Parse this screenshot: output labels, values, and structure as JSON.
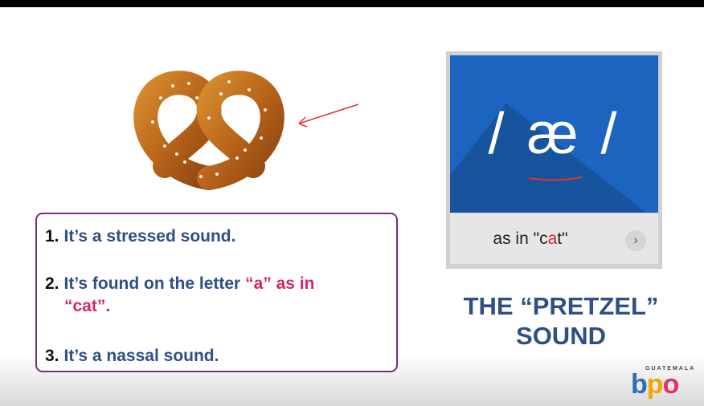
{
  "slide": {
    "list": [
      {
        "number": "1.",
        "text": "It’s a stressed sound."
      },
      {
        "number": "2.",
        "text_before": "It’s found on the letter ",
        "highlight": "“a” as in",
        "line2": "“cat”."
      },
      {
        "number": "3.",
        "text": "It’s a nassal sound."
      }
    ],
    "card": {
      "symbol": "/ æ /",
      "example_prefix": "as in \"c",
      "example_red": "a",
      "example_suffix": "t\"",
      "next_icon": "›"
    },
    "title_line1": "THE “PRETZEL”",
    "title_line2": "SOUND",
    "logo": {
      "top": "GUATEMALA",
      "b": "b",
      "p": "p",
      "o": "o"
    }
  },
  "icons": {
    "pretzel": "pretzel-image",
    "arrow": "hand-drawn-arrow",
    "next": "chevron-right-icon"
  },
  "colors": {
    "list_text": "#2f4f86",
    "highlight": "#d8246c",
    "border": "#7a2b85",
    "card_blue": "#1c64c0"
  }
}
